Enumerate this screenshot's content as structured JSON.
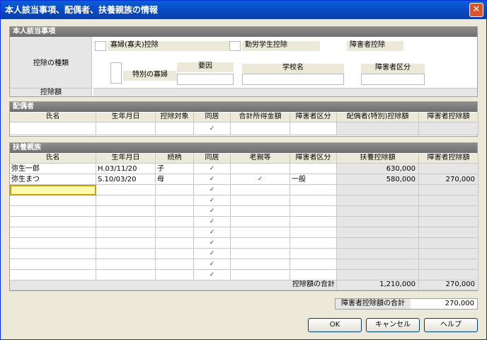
{
  "window": {
    "title": "本人該当事項、配偶者、扶養親族の情報"
  },
  "self": {
    "header": "本人該当事項",
    "deduction_type_label": "控除の種類",
    "deduction_amount_label": "控除額",
    "widow_label": "寡婦(寡夫)控除",
    "special_widow_label": "特別の寡婦",
    "reason_label": "要因",
    "student_label": "勤労学生控除",
    "school_label": "学校名",
    "disability_label": "障害者控除",
    "disability_class_label": "障害者区分"
  },
  "spouse": {
    "header": "配偶者",
    "columns": [
      "氏名",
      "生年月日",
      "控除対象",
      "同居",
      "合計所得金額",
      "障害者区分",
      "配偶者(特別)控除額",
      "障害者控除額"
    ],
    "row": {
      "cohabit": "✓"
    }
  },
  "dependents": {
    "header": "扶養親族",
    "columns": [
      "氏名",
      "生年月日",
      "続柄",
      "同居",
      "老親等",
      "障害者区分",
      "扶養控除額",
      "障害者控除額"
    ],
    "rows": [
      {
        "name": "弥生一郎",
        "birth": "H.03/11/20",
        "relation": "子",
        "cohabit": "✓",
        "elder": "",
        "disability": "",
        "deduction": "630,000",
        "disability_deduction": ""
      },
      {
        "name": "弥生まつ",
        "birth": "S.10/03/20",
        "relation": "母",
        "cohabit": "✓",
        "elder": "✓",
        "disability": "一般",
        "deduction": "580,000",
        "disability_deduction": "270,000"
      },
      {
        "name": "",
        "birth": "",
        "relation": "",
        "cohabit": "✓",
        "elder": "",
        "disability": "",
        "deduction": "",
        "disability_deduction": ""
      },
      {
        "name": "",
        "birth": "",
        "relation": "",
        "cohabit": "✓",
        "elder": "",
        "disability": "",
        "deduction": "",
        "disability_deduction": ""
      },
      {
        "name": "",
        "birth": "",
        "relation": "",
        "cohabit": "✓",
        "elder": "",
        "disability": "",
        "deduction": "",
        "disability_deduction": ""
      },
      {
        "name": "",
        "birth": "",
        "relation": "",
        "cohabit": "✓",
        "elder": "",
        "disability": "",
        "deduction": "",
        "disability_deduction": ""
      },
      {
        "name": "",
        "birth": "",
        "relation": "",
        "cohabit": "✓",
        "elder": "",
        "disability": "",
        "deduction": "",
        "disability_deduction": ""
      },
      {
        "name": "",
        "birth": "",
        "relation": "",
        "cohabit": "✓",
        "elder": "",
        "disability": "",
        "deduction": "",
        "disability_deduction": ""
      },
      {
        "name": "",
        "birth": "",
        "relation": "",
        "cohabit": "✓",
        "elder": "",
        "disability": "",
        "deduction": "",
        "disability_deduction": ""
      },
      {
        "name": "",
        "birth": "",
        "relation": "",
        "cohabit": "✓",
        "elder": "",
        "disability": "",
        "deduction": "",
        "disability_deduction": ""
      },
      {
        "name": "",
        "birth": "",
        "relation": "",
        "cohabit": "✓",
        "elder": "",
        "disability": "",
        "deduction": "",
        "disability_deduction": ""
      }
    ],
    "total_label": "控除額の合計",
    "total_deduction": "1,210,000",
    "total_disability": "270,000"
  },
  "summary": {
    "label": "障害者控除額の合計",
    "value": "270,000"
  },
  "buttons": {
    "ok": "OK",
    "cancel": "キャンセル",
    "help": "ヘルプ"
  }
}
